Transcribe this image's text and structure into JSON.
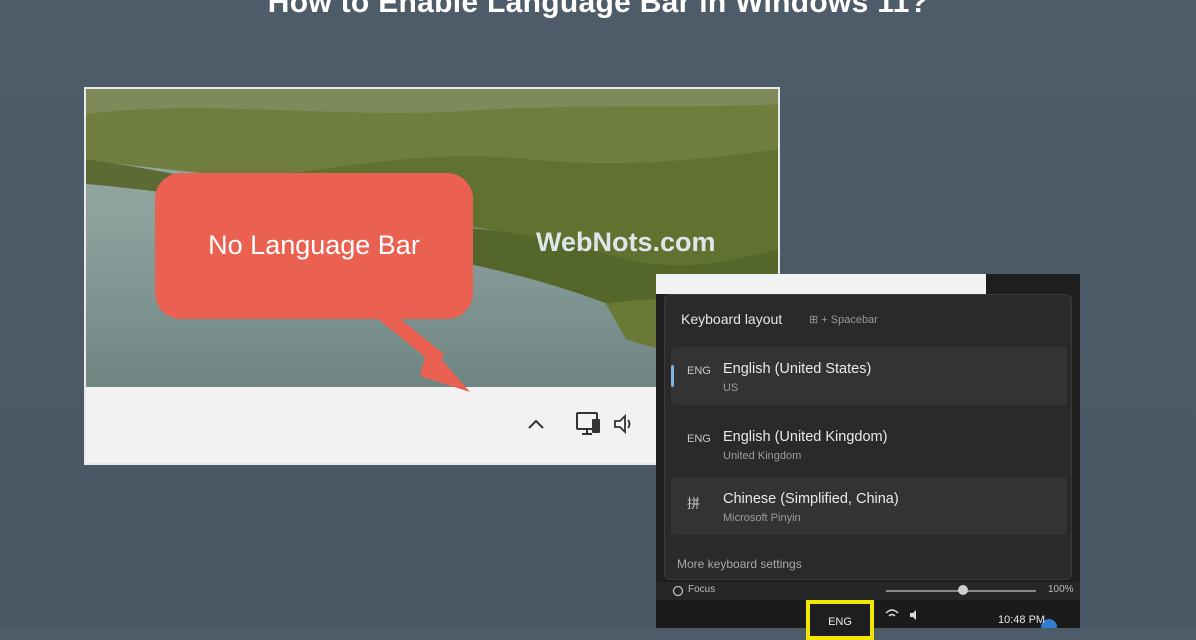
{
  "title": "How to Enable Language Bar in Windows 11?",
  "desktop": {
    "watermark": "WebNots.com",
    "callout": "No Language Bar",
    "tray_icons": [
      "chevron-up-icon",
      "display-network-icon",
      "speaker-icon"
    ]
  },
  "flyout": {
    "header": "Keyboard layout",
    "shortcut": "⊞ + Spacebar",
    "languages": [
      {
        "code": "ENG",
        "name": "English (United States)",
        "sub": "US",
        "selected": true
      },
      {
        "code": "ENG",
        "name": "English (United Kingdom)",
        "sub": "United Kingdom",
        "selected": false
      },
      {
        "code": "拼",
        "name": "Chinese (Simplified, China)",
        "sub": "Microsoft Pinyin",
        "selected": false
      }
    ],
    "more_settings": "More keyboard settings"
  },
  "quickbar": {
    "left": "Focus",
    "right": "100%"
  },
  "taskbar": {
    "language_indicator": "ENG",
    "clock": "10:48 PM"
  },
  "colors": {
    "background": "#4e5c69",
    "callout": "#ea6151",
    "highlight": "#f2e600",
    "flyout": "#2a2a2a"
  }
}
